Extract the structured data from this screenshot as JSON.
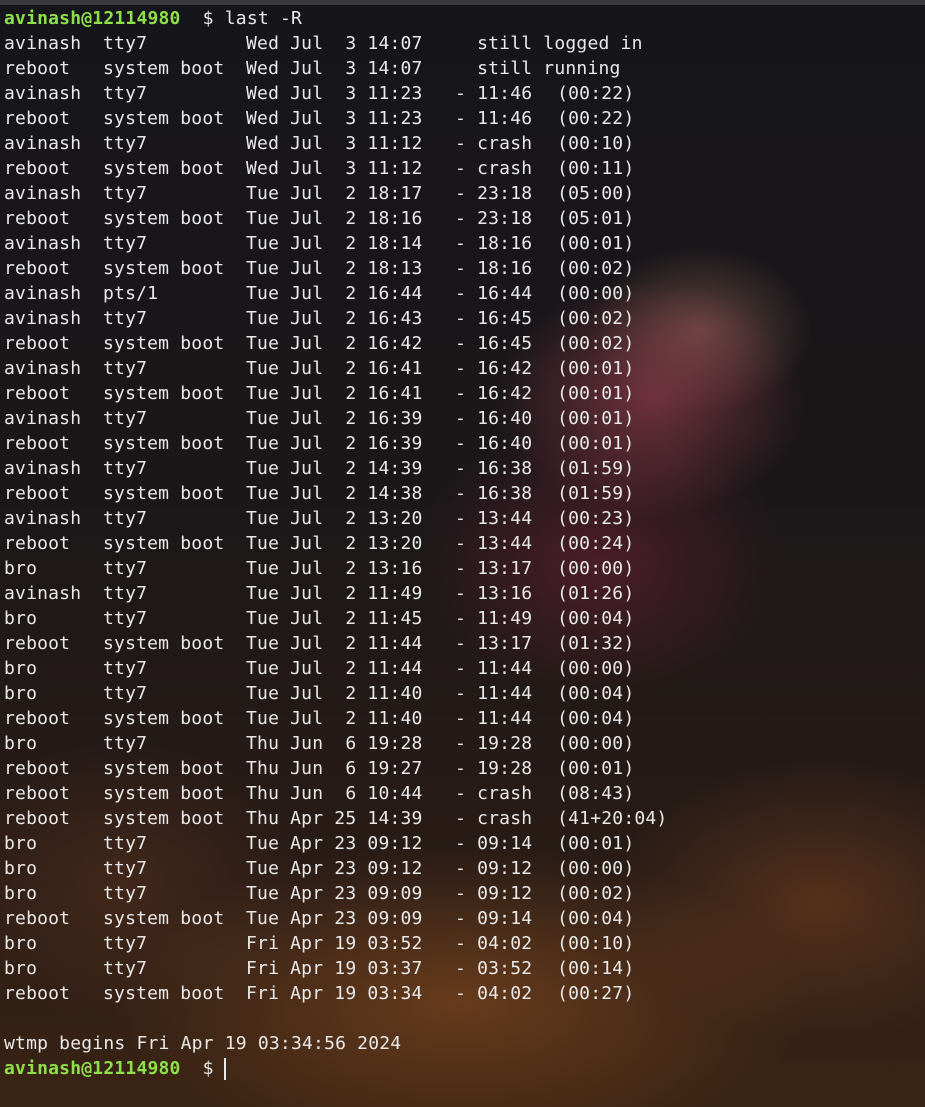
{
  "prompt": {
    "user_host": "avinash@12114980",
    "symbol": "$",
    "command": "last -R"
  },
  "sessions": [
    {
      "user": "avinash",
      "tty": "tty7",
      "login": "Wed Jul  3 14:07",
      "sep": "",
      "end": "still logged in",
      "dur": ""
    },
    {
      "user": "reboot",
      "tty": "system boot",
      "login": "Wed Jul  3 14:07",
      "sep": "",
      "end": "still running",
      "dur": ""
    },
    {
      "user": "avinash",
      "tty": "tty7",
      "login": "Wed Jul  3 11:23",
      "sep": "-",
      "end": "11:46",
      "dur": "(00:22)"
    },
    {
      "user": "reboot",
      "tty": "system boot",
      "login": "Wed Jul  3 11:23",
      "sep": "-",
      "end": "11:46",
      "dur": "(00:22)"
    },
    {
      "user": "avinash",
      "tty": "tty7",
      "login": "Wed Jul  3 11:12",
      "sep": "-",
      "end": "crash",
      "dur": "(00:10)"
    },
    {
      "user": "reboot",
      "tty": "system boot",
      "login": "Wed Jul  3 11:12",
      "sep": "-",
      "end": "crash",
      "dur": "(00:11)"
    },
    {
      "user": "avinash",
      "tty": "tty7",
      "login": "Tue Jul  2 18:17",
      "sep": "-",
      "end": "23:18",
      "dur": "(05:00)"
    },
    {
      "user": "reboot",
      "tty": "system boot",
      "login": "Tue Jul  2 18:16",
      "sep": "-",
      "end": "23:18",
      "dur": "(05:01)"
    },
    {
      "user": "avinash",
      "tty": "tty7",
      "login": "Tue Jul  2 18:14",
      "sep": "-",
      "end": "18:16",
      "dur": "(00:01)"
    },
    {
      "user": "reboot",
      "tty": "system boot",
      "login": "Tue Jul  2 18:13",
      "sep": "-",
      "end": "18:16",
      "dur": "(00:02)"
    },
    {
      "user": "avinash",
      "tty": "pts/1",
      "login": "Tue Jul  2 16:44",
      "sep": "-",
      "end": "16:44",
      "dur": "(00:00)"
    },
    {
      "user": "avinash",
      "tty": "tty7",
      "login": "Tue Jul  2 16:43",
      "sep": "-",
      "end": "16:45",
      "dur": "(00:02)"
    },
    {
      "user": "reboot",
      "tty": "system boot",
      "login": "Tue Jul  2 16:42",
      "sep": "-",
      "end": "16:45",
      "dur": "(00:02)"
    },
    {
      "user": "avinash",
      "tty": "tty7",
      "login": "Tue Jul  2 16:41",
      "sep": "-",
      "end": "16:42",
      "dur": "(00:01)"
    },
    {
      "user": "reboot",
      "tty": "system boot",
      "login": "Tue Jul  2 16:41",
      "sep": "-",
      "end": "16:42",
      "dur": "(00:01)"
    },
    {
      "user": "avinash",
      "tty": "tty7",
      "login": "Tue Jul  2 16:39",
      "sep": "-",
      "end": "16:40",
      "dur": "(00:01)"
    },
    {
      "user": "reboot",
      "tty": "system boot",
      "login": "Tue Jul  2 16:39",
      "sep": "-",
      "end": "16:40",
      "dur": "(00:01)"
    },
    {
      "user": "avinash",
      "tty": "tty7",
      "login": "Tue Jul  2 14:39",
      "sep": "-",
      "end": "16:38",
      "dur": "(01:59)"
    },
    {
      "user": "reboot",
      "tty": "system boot",
      "login": "Tue Jul  2 14:38",
      "sep": "-",
      "end": "16:38",
      "dur": "(01:59)"
    },
    {
      "user": "avinash",
      "tty": "tty7",
      "login": "Tue Jul  2 13:20",
      "sep": "-",
      "end": "13:44",
      "dur": "(00:23)"
    },
    {
      "user": "reboot",
      "tty": "system boot",
      "login": "Tue Jul  2 13:20",
      "sep": "-",
      "end": "13:44",
      "dur": "(00:24)"
    },
    {
      "user": "bro",
      "tty": "tty7",
      "login": "Tue Jul  2 13:16",
      "sep": "-",
      "end": "13:17",
      "dur": "(00:00)"
    },
    {
      "user": "avinash",
      "tty": "tty7",
      "login": "Tue Jul  2 11:49",
      "sep": "-",
      "end": "13:16",
      "dur": "(01:26)"
    },
    {
      "user": "bro",
      "tty": "tty7",
      "login": "Tue Jul  2 11:45",
      "sep": "-",
      "end": "11:49",
      "dur": "(00:04)"
    },
    {
      "user": "reboot",
      "tty": "system boot",
      "login": "Tue Jul  2 11:44",
      "sep": "-",
      "end": "13:17",
      "dur": "(01:32)"
    },
    {
      "user": "bro",
      "tty": "tty7",
      "login": "Tue Jul  2 11:44",
      "sep": "-",
      "end": "11:44",
      "dur": "(00:00)"
    },
    {
      "user": "bro",
      "tty": "tty7",
      "login": "Tue Jul  2 11:40",
      "sep": "-",
      "end": "11:44",
      "dur": "(00:04)"
    },
    {
      "user": "reboot",
      "tty": "system boot",
      "login": "Tue Jul  2 11:40",
      "sep": "-",
      "end": "11:44",
      "dur": "(00:04)"
    },
    {
      "user": "bro",
      "tty": "tty7",
      "login": "Thu Jun  6 19:28",
      "sep": "-",
      "end": "19:28",
      "dur": "(00:00)"
    },
    {
      "user": "reboot",
      "tty": "system boot",
      "login": "Thu Jun  6 19:27",
      "sep": "-",
      "end": "19:28",
      "dur": "(00:01)"
    },
    {
      "user": "reboot",
      "tty": "system boot",
      "login": "Thu Jun  6 10:44",
      "sep": "-",
      "end": "crash",
      "dur": "(08:43)"
    },
    {
      "user": "reboot",
      "tty": "system boot",
      "login": "Thu Apr 25 14:39",
      "sep": "-",
      "end": "crash",
      "dur": "(41+20:04)"
    },
    {
      "user": "bro",
      "tty": "tty7",
      "login": "Tue Apr 23 09:12",
      "sep": "-",
      "end": "09:14",
      "dur": "(00:01)"
    },
    {
      "user": "bro",
      "tty": "tty7",
      "login": "Tue Apr 23 09:12",
      "sep": "-",
      "end": "09:12",
      "dur": "(00:00)"
    },
    {
      "user": "bro",
      "tty": "tty7",
      "login": "Tue Apr 23 09:09",
      "sep": "-",
      "end": "09:12",
      "dur": "(00:02)"
    },
    {
      "user": "reboot",
      "tty": "system boot",
      "login": "Tue Apr 23 09:09",
      "sep": "-",
      "end": "09:14",
      "dur": "(00:04)"
    },
    {
      "user": "bro",
      "tty": "tty7",
      "login": "Fri Apr 19 03:52",
      "sep": "-",
      "end": "04:02",
      "dur": "(00:10)"
    },
    {
      "user": "bro",
      "tty": "tty7",
      "login": "Fri Apr 19 03:37",
      "sep": "-",
      "end": "03:52",
      "dur": "(00:14)"
    },
    {
      "user": "reboot",
      "tty": "system boot",
      "login": "Fri Apr 19 03:34",
      "sep": "-",
      "end": "04:02",
      "dur": "(00:27)"
    }
  ],
  "footer": "wtmp begins Fri Apr 19 03:34:56 2024",
  "colors": {
    "prompt_user": "#8ee04a",
    "text": "#e9e9e9"
  }
}
